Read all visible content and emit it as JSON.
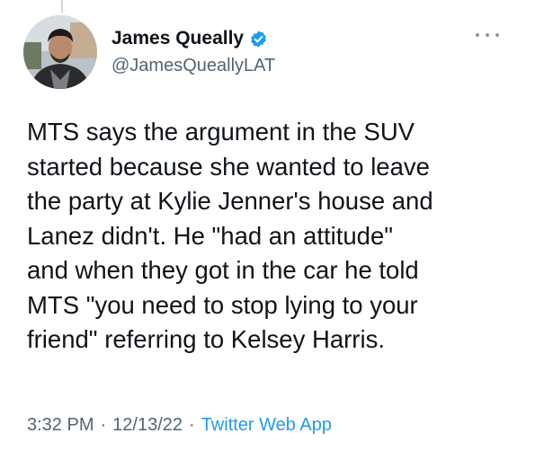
{
  "author": {
    "display_name": "James Queally",
    "handle": "@JamesQueallyLAT",
    "verified": true,
    "avatar": "profile-photo"
  },
  "tweet": {
    "text": "MTS says the argument in the SUV\nstarted because she wanted to leave\nthe party at Kylie Jenner's house and\nLanez didn't. He \"had an attitude\"\nand when they got in the car he told\nMTS \"you need to stop lying to your\nfriend\" referring to Kelsey Harris."
  },
  "meta": {
    "time": "3:32 PM",
    "separator": "·",
    "date": "12/13/22",
    "source": "Twitter Web App"
  },
  "icons": {
    "verified": "verified-badge-icon",
    "more": "more-options-icon"
  },
  "colors": {
    "verified_badge": "#1d9bf0",
    "source_link": "#1d9bf0",
    "secondary_text": "#536471",
    "primary_text": "#0f1419"
  }
}
